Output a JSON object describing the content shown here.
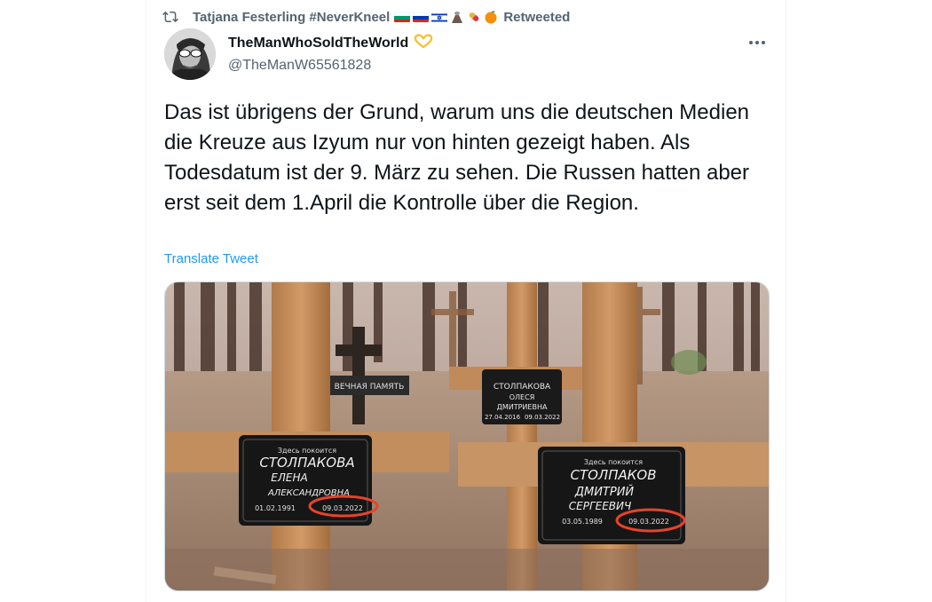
{
  "retweet": {
    "user": "Tatjana Festerling #NeverKneel",
    "label": "Retweeted",
    "icon": "retweet-icon",
    "flags": [
      "bulgaria-flag",
      "russia-flag",
      "israel-flag",
      "volcano-emoji",
      "pill-emoji",
      "orange-emoji"
    ]
  },
  "author": {
    "display_name": "TheManWhoSoldTheWorld",
    "badge": "yellow-heart-hands-emoji",
    "handle": "@TheManW65561828"
  },
  "tweet": {
    "text": "Das ist übrigens der Grund, warum uns die deutschen Medien die Kreuze aus Izyum nur von hinten gezeigt haben. Als Todesdatum ist der 9. März zu sehen. Die Russen hatten aber erst seit dem 1.April die Kontrolle über die Region.",
    "translate_label": "Translate Tweet"
  },
  "media": {
    "description_icon": "photo-of-grave-crosses",
    "plaques": {
      "left": {
        "line1": "Здесь покоится",
        "surname": "СТОЛПАКОВА",
        "name": "ЕЛЕНА",
        "patronymic": "АЛЕКСАНДРОВНА",
        "birth": "01.02.1991",
        "death": "09.03.2022"
      },
      "right": {
        "line1": "Здесь покоится",
        "surname": "СТОЛПАКОВ",
        "name": "ДМИТРИЙ",
        "patronymic": "СЕРГЕЕВИЧ",
        "birth": "03.05.1989",
        "death": "09.03.2022"
      },
      "middle": {
        "surname": "СТОЛПАКОВА",
        "name": "ОЛЕСЯ",
        "patronymic": "ДМИТРИЕВНА",
        "birth": "27.04.2016",
        "death": "09.03.2022"
      },
      "back": {
        "text": "ВЕЧНАЯ ПАМЯТЬ"
      }
    },
    "highlight_color": "#e8432a"
  },
  "colors": {
    "secondary_text": "#536471",
    "link": "#1d9bf0",
    "primary_text": "#0f1419"
  }
}
